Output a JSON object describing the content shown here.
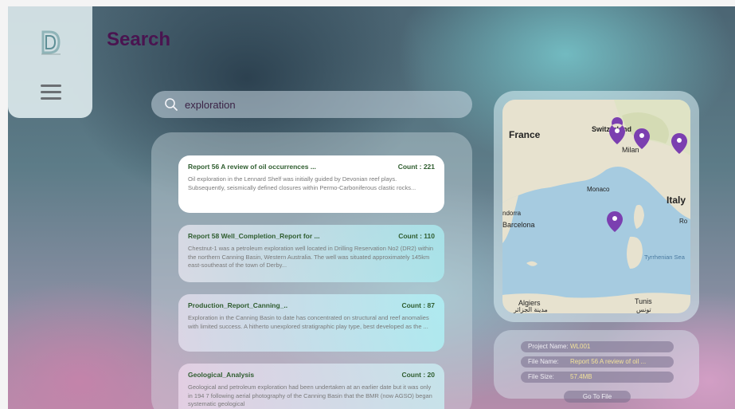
{
  "header": {
    "title": "Search"
  },
  "search": {
    "value": "exploration"
  },
  "results": [
    {
      "title": "Report 56 A review of oil occurrences ...",
      "count": "Count : 221",
      "snippet": "Oil exploration in the Lennard Shelf was initially guided by Devonian reef plays. Subsequently, seismically defined closures within Permo-Carboniferous clastic rocks..."
    },
    {
      "title": "Report 58 Well_Completion_Report for ...",
      "count": "Count : 110",
      "snippet": "Chestnut-1 was a petroleum exploration well located in Drilling Reservation No2 (DR2) within the northern Canning Basin, Western Australia. The well was situated approximately 145km east-southeast of the town of Derby..."
    },
    {
      "title": "Production_Report_Canning_..",
      "count": "Count : 87",
      "snippet": "Exploration in the Canning Basin to date has concentrated on structural and reef anomalies with limited success. A hitherto unexplored stratigraphic play type, best developed as the ..."
    },
    {
      "title": "Geological_Analysis",
      "count": "Count : 20",
      "snippet": "Geological and petroleum exploration had been undertaken at an earlier date but it was only in 194 7 following aerial photography of the Canning Basin that the BMR (now AGSO) began systematic geological"
    }
  ],
  "map": {
    "labels": {
      "france": "France",
      "switzerland": "Switzerland",
      "milan": "Milan",
      "monaco": "Monaco",
      "italy": "Italy",
      "andorra": "ndorra",
      "barcelona": "Barcelona",
      "rome": "Ro",
      "tyrrhenian": "Tyrrhenian Sea",
      "algiers": "Algiers",
      "algiers_ar": "مدينة الجزائر",
      "tunis": "Tunis",
      "tunis_ar": "تونس"
    },
    "pin_color": "#7b3fb0",
    "marker_icon": "map-pin-icon"
  },
  "file_info": {
    "project_label": "Project Name:",
    "project_value": "WL001",
    "file_label": "File Name:",
    "file_value": "Report 56 A review of oil ...",
    "size_label": "File Size:",
    "size_value": "57.4MB",
    "goto_label": "Go To File"
  }
}
